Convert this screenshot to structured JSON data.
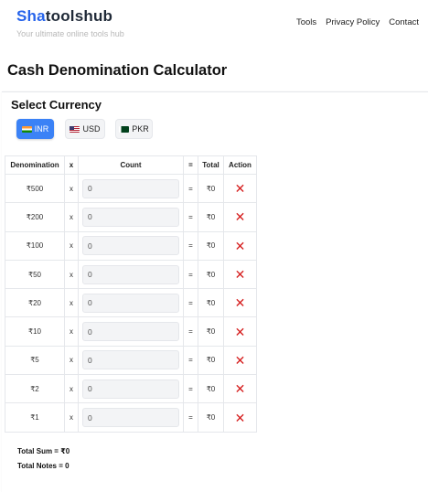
{
  "header": {
    "logo_part1": "Sha",
    "logo_part2": "toolshub",
    "tagline": "Your ultimate online tools hub",
    "nav": [
      "Tools",
      "Privacy Policy",
      "Contact"
    ]
  },
  "page_title": "Cash Denomination Calculator",
  "currency": {
    "title": "Select Currency",
    "options": [
      {
        "label": "INR",
        "flag": "india-flag-icon",
        "selected": true
      },
      {
        "label": "USD",
        "flag": "us-flag-icon",
        "selected": false
      },
      {
        "label": "PKR",
        "flag": "pakistan-flag-icon",
        "selected": false
      }
    ]
  },
  "table": {
    "headers": [
      "Denomination",
      "x",
      "Count",
      "=",
      "Total",
      "Action"
    ],
    "rows": [
      {
        "denomination": "₹500",
        "x": "x",
        "count": "0",
        "eq": "=",
        "total": "₹0"
      },
      {
        "denomination": "₹200",
        "x": "x",
        "count": "0",
        "eq": "=",
        "total": "₹0"
      },
      {
        "denomination": "₹100",
        "x": "x",
        "count": "0",
        "eq": "=",
        "total": "₹0"
      },
      {
        "denomination": "₹50",
        "x": "x",
        "count": "0",
        "eq": "=",
        "total": "₹0"
      },
      {
        "denomination": "₹20",
        "x": "x",
        "count": "0",
        "eq": "=",
        "total": "₹0"
      },
      {
        "denomination": "₹10",
        "x": "x",
        "count": "0",
        "eq": "=",
        "total": "₹0"
      },
      {
        "denomination": "₹5",
        "x": "x",
        "count": "0",
        "eq": "=",
        "total": "₹0"
      },
      {
        "denomination": "₹2",
        "x": "x",
        "count": "0",
        "eq": "=",
        "total": "₹0"
      },
      {
        "denomination": "₹1",
        "x": "x",
        "count": "0",
        "eq": "=",
        "total": "₹0"
      }
    ],
    "delete_glyph": "✕"
  },
  "summary": {
    "total_sum": "Total Sum = ₹0",
    "total_notes": "Total Notes = 0"
  },
  "colors": {
    "brand_blue": "#2563eb",
    "active_button": "#3b82f6",
    "delete_red": "#d61f1f"
  }
}
